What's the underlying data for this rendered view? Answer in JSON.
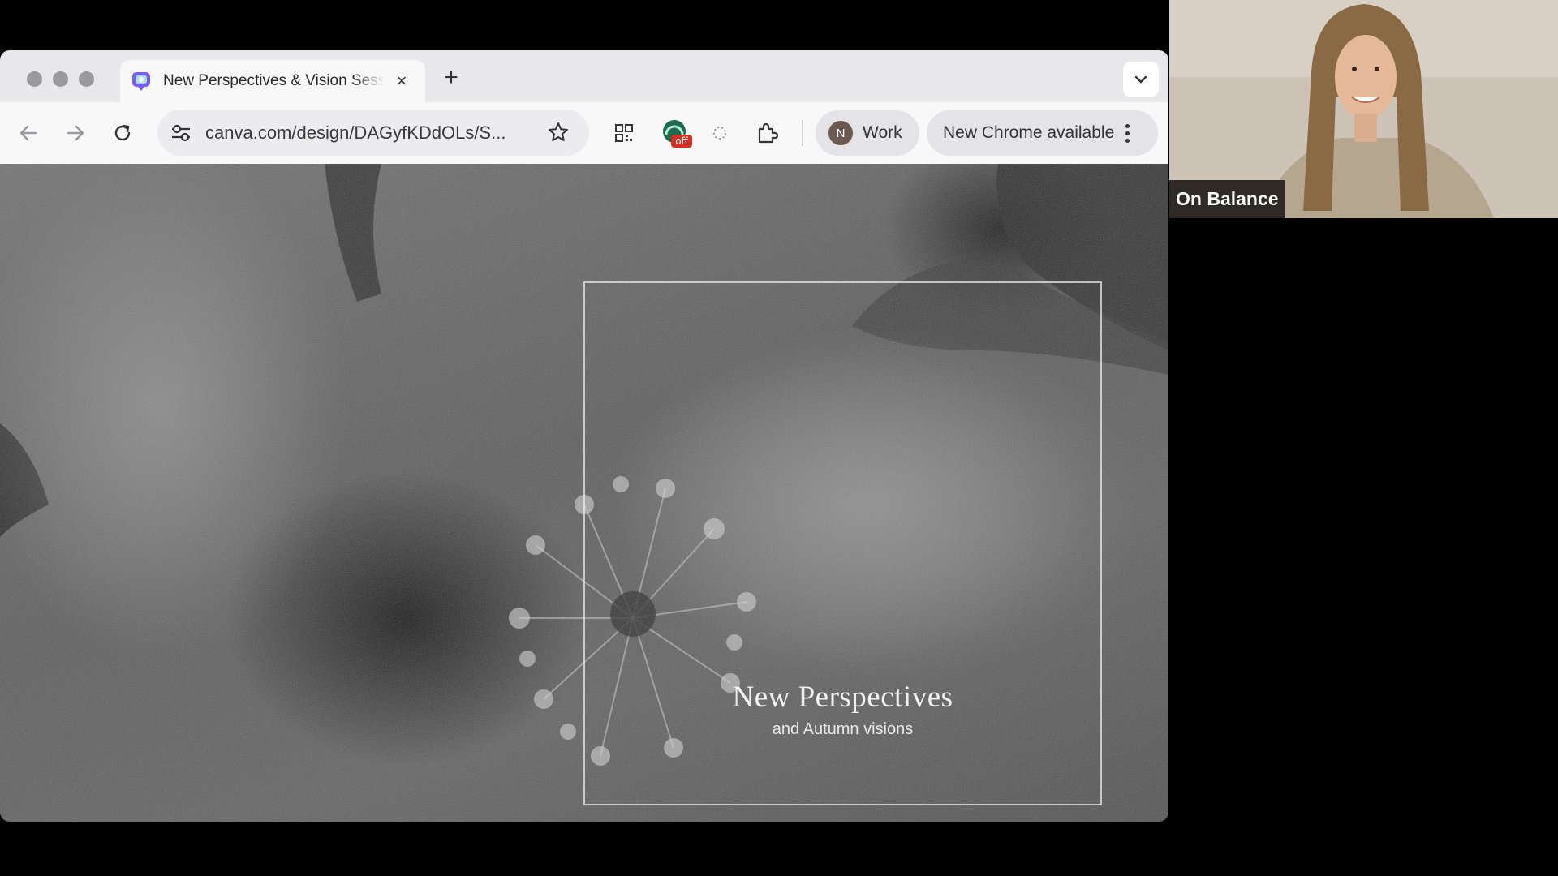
{
  "browser": {
    "tab": {
      "title": "New Perspectives & Vision Session",
      "close_glyph": "×"
    },
    "new_tab_glyph": "+",
    "address_bar": {
      "url": "canva.com/design/DAGyfKDdOLs/S..."
    },
    "extension_badge": "off",
    "profile": {
      "initial": "N",
      "label": "Work"
    },
    "update_button": {
      "label": "New Chrome available"
    },
    "colors": {
      "chrome_bg": "#e8e8ea",
      "toolbar_bg": "#f8f8f9",
      "badge_red": "#d93025"
    }
  },
  "slide": {
    "title": "New Perspectives",
    "subtitle": "and Autumn visions"
  },
  "participant": {
    "name": "On Balance"
  },
  "icons": [
    "tab-favicon-icon",
    "close-icon",
    "plus-icon",
    "chevron-down-icon",
    "back-arrow-icon",
    "forward-arrow-icon",
    "reload-icon",
    "site-settings-icon",
    "star-icon",
    "qr-code-icon",
    "extension-off-icon",
    "sparkle-icon",
    "puzzle-icon",
    "more-vert-icon"
  ]
}
